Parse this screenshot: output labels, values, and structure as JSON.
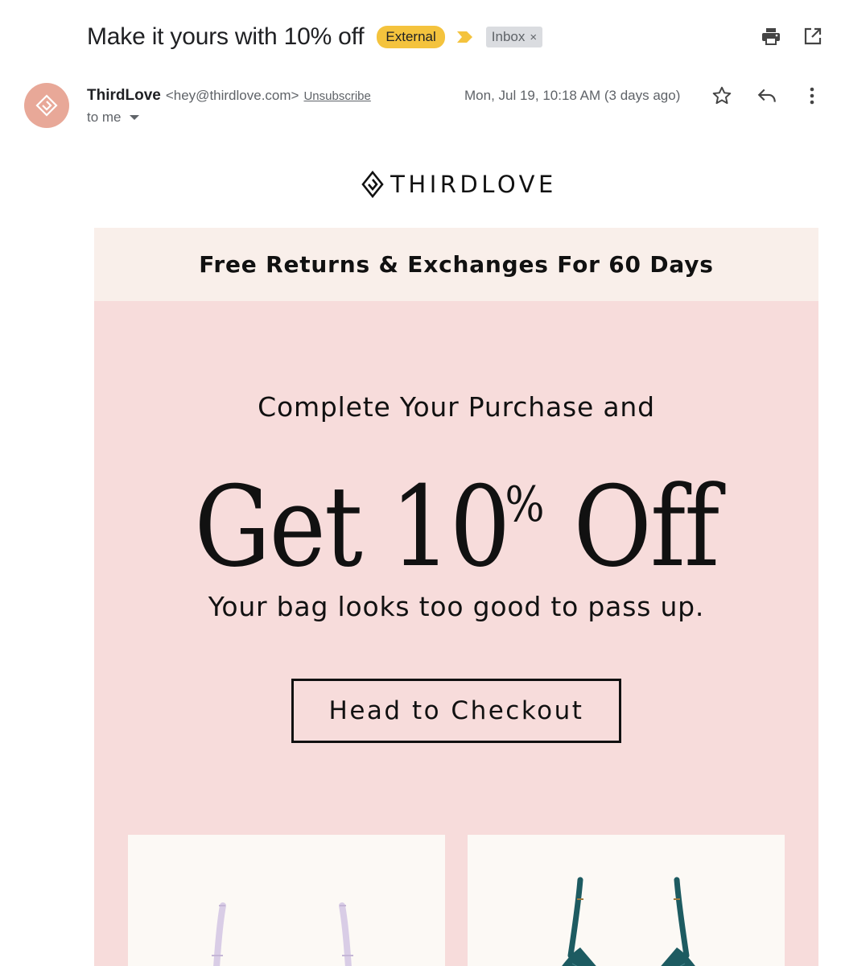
{
  "email": {
    "subject": "Make it yours with 10% off",
    "labels": {
      "external": "External",
      "inbox": "Inbox",
      "inbox_remove": "×"
    },
    "sender": {
      "name": "ThirdLove",
      "email": "<hey@thirdlove.com>",
      "unsubscribe": "Unsubscribe",
      "avatar_color": "#e8a898"
    },
    "recipient": "to me",
    "date": "Mon, Jul 19, 10:18 AM (3 days ago)",
    "icons": {
      "print": "print-icon",
      "open_new_window": "open-in-new-window-icon",
      "star": "star-icon",
      "reply": "reply-icon",
      "more": "more-vert-icon",
      "importance": "importance-marker-icon"
    },
    "colors": {
      "external_label": "#f4c33d",
      "importance_marker": "#f4c33d",
      "inbox_label": "#dadce0"
    }
  },
  "content": {
    "brand": "THIRDLOVE",
    "banner": "Free Returns & Exchanges For 60 Days",
    "hero_sub": "Complete Your Purchase and",
    "hero_title": "Get 10",
    "hero_title_percent": "%",
    "hero_title_end": " Off",
    "hero_tagline": "Your bag looks too good to pass up.",
    "cta": "Head to Checkout",
    "colors": {
      "banner_bg": "#f9efea",
      "hero_bg": "#f7dcdb",
      "card_bg": "#fcf9f5",
      "product_left": "#d9cde6",
      "product_right": "#1d5b61"
    }
  }
}
